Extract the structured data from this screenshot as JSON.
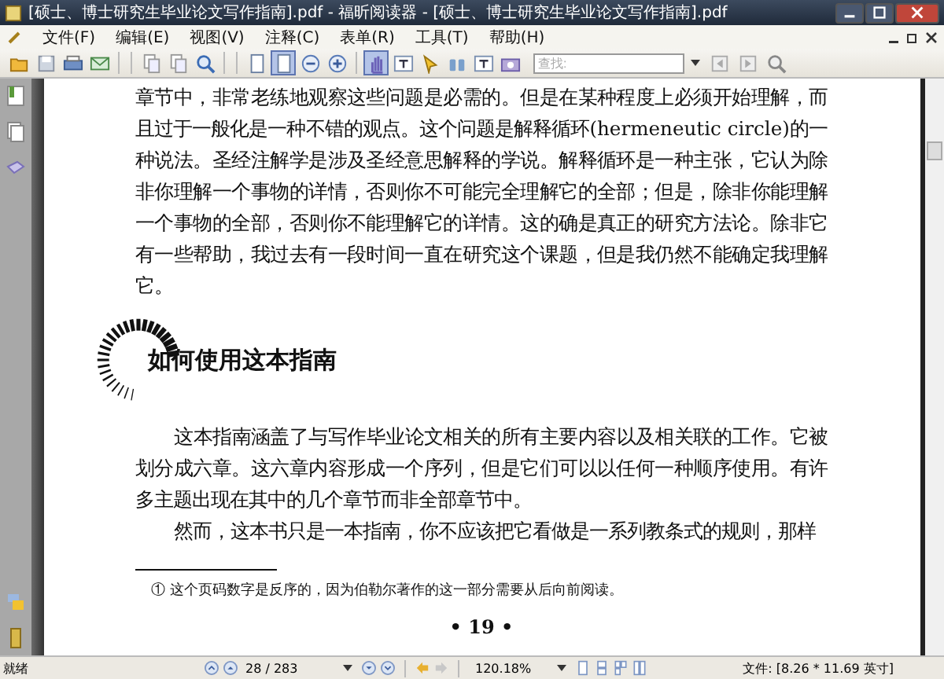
{
  "window": {
    "title": "[硕士、博士研究生毕业论文写作指南].pdf - 福昕阅读器 - [硕士、博士研究生毕业论文写作指南].pdf"
  },
  "menu": [
    "文件(F)",
    "编辑(E)",
    "视图(V)",
    "注释(C)",
    "表单(R)",
    "工具(T)",
    "帮助(H)"
  ],
  "toolbar": {
    "tools": [
      {
        "kind": "open",
        "selected": false
      },
      {
        "kind": "save",
        "selected": false
      },
      {
        "kind": "print",
        "selected": false
      },
      {
        "kind": "email",
        "selected": false
      },
      {
        "kind": "copy",
        "selected": false
      },
      {
        "kind": "copy",
        "selected": false
      },
      {
        "kind": "zoom",
        "selected": false
      },
      {
        "kind": "page",
        "selected": false
      },
      {
        "kind": "page",
        "selected": true
      },
      {
        "kind": "minus",
        "selected": false
      },
      {
        "kind": "plus",
        "selected": false
      },
      {
        "kind": "hand",
        "selected": true
      },
      {
        "kind": "text",
        "selected": false
      },
      {
        "kind": "pointer",
        "selected": false
      },
      {
        "kind": "binoculars",
        "selected": false
      },
      {
        "kind": "text",
        "selected": false
      },
      {
        "kind": "camera",
        "selected": false
      }
    ],
    "search": {
      "placeholder": "查找:"
    }
  },
  "page": {
    "paragraphs": [
      "章节中，非常老练地观察这些问题是必需的。但是在某种程度上必须开始理解，而且过于一般化是一种不错的观点。这个问题是解释循环(hermeneutic circle)的一种说法。圣经注解学是涉及圣经意思解释的学说。解释循环是一种主张，它认为除非你理解一个事物的详情，否则你不可能完全理解它的全部；但是，除非你能理解一个事物的全部，否则你不能理解它的详情。这的确是真正的研究方法论。除非它有一些帮助，我过去有一段时间一直在研究这个课题，但是我仍然不能确定我理解它。"
    ],
    "heading": "如何使用这本指南",
    "body": [
      "这本指南涵盖了与写作毕业论文相关的所有主要内容以及相关联的工作。它被划分成六章。这六章内容形成一个序列，但是它们可以以任何一种顺序使用。有许多主题出现在其中的几个章节而非全部章节中。",
      "然而，这本书只是一本指南，你不应该把它看做是一系列教条式的规则，那样"
    ],
    "footnote": "① 这个页码数字是反序的，因为伯勒尔著作的这一部分需要从后向前阅读。",
    "page_number": "• 19 •"
  },
  "status_bar": {
    "status": "就绪",
    "page_field": "28 / 283",
    "zoom": "120.18%",
    "doc_size": "文件: [8.26 * 11.69 英寸]"
  }
}
